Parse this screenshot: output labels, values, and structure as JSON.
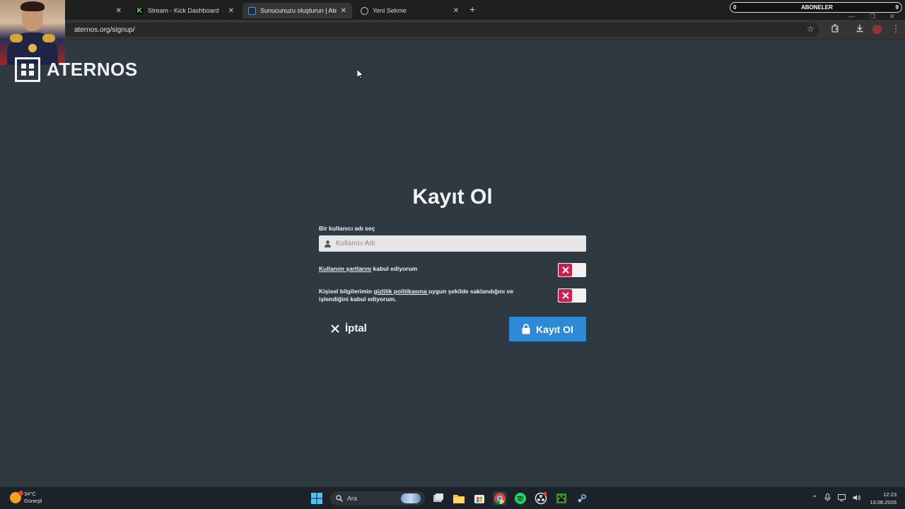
{
  "browser": {
    "tabs": [
      {
        "title": "",
        "active": false
      },
      {
        "title": "Stream - Kick Dashboard",
        "active": false
      },
      {
        "title": "Sunucunuzu oluşturun | Aterno",
        "active": true
      },
      {
        "title": "Yeni Sekme",
        "active": false
      }
    ],
    "new_tab": "+",
    "url": "aternos.org/signup/"
  },
  "overlay": {
    "subscribers_count": "0",
    "subscribers_label": "ABONELER",
    "subscribers_goal": "9"
  },
  "page": {
    "logo_text": "ATERNOS",
    "title": "Kayıt Ol",
    "username_label": "Bir kullanıcı adı seç",
    "username_placeholder": "Kullanıcı Adı",
    "username_value": "",
    "terms": {
      "link": "Kullanım şartlarını",
      "text": " kabul ediyorum",
      "accepted": false
    },
    "privacy": {
      "prefix": "Kişisel bilgilerimin ",
      "link": "gizlilik politikasına ",
      "suffix": "uygun şekilde saklandığını ve işlendiğini kabul ediyorum.",
      "accepted": false
    },
    "cancel_label": "İptal",
    "submit_label": "Kayıt Ol",
    "accent_color": "#2f8ad6",
    "toggle_off_color": "#c9204d"
  },
  "taskbar": {
    "weather_temp": "34°C",
    "weather_desc": "Güneşli",
    "search_placeholder": "Ara",
    "time": "12:23",
    "date": "13.08.2026"
  }
}
